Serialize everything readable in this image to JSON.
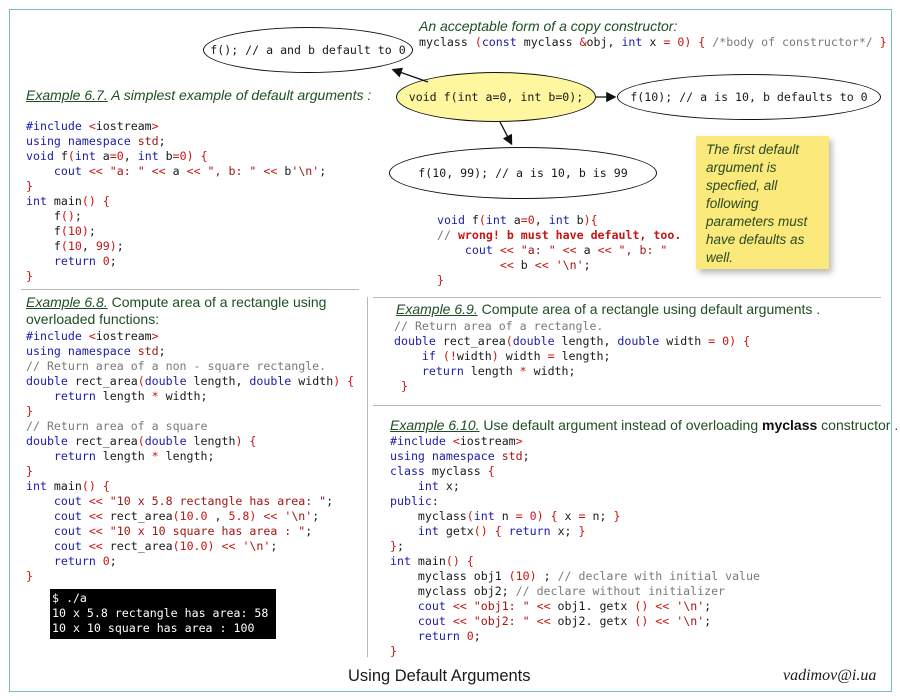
{
  "copy_ctor": {
    "heading": "An acceptable form of a copy constructor:",
    "code": "myclass (const myclass &obj, int x = 0) { /*body of constructor*/ }"
  },
  "diagram": {
    "center": "void f(int a=0, int b=0);",
    "left": "f(); // a and b default to 0",
    "right": "f(10); // a is 10, b defaults to 0",
    "bottom": "f(10, 99); // a is 10, b is 99"
  },
  "note": {
    "text": "The first default argument is specfied, all following parameters must have defaults as well."
  },
  "ex67": {
    "label": "Example 6.7.",
    "title": " A simplest  example of default arguments :"
  },
  "ex68": {
    "label": "Example 6.8.",
    "title_line1": " Compute area of a rectangle using",
    "title_line2": "overloaded functions:"
  },
  "ex69": {
    "label": "Example 6.9.",
    "title": " Compute area of a rectangle using default arguments ."
  },
  "ex610": {
    "label": "Example 6.10.",
    "title_pre": " Use default argument instead of overloading ",
    "title_bold": "myclass",
    "title_post": " constructor ."
  },
  "terminal": {
    "lines": [
      "$ ./a",
      "10 x 5.8 rectangle has area: 58",
      "10 x 10 square has area : 100"
    ]
  },
  "footer": {
    "title": "Using Default Arguments",
    "email": "vadimov@i.ua"
  },
  "colors": {
    "accent_green": "#1f4e24",
    "keyword_blue": "#1b1ba8",
    "operator_red": "#c81414",
    "comment_gray": "#7a7a7a",
    "note_yellow": "#fbe97c",
    "ellipse_yellow": "#fff6a0",
    "frame_teal": "#78bcc0"
  }
}
